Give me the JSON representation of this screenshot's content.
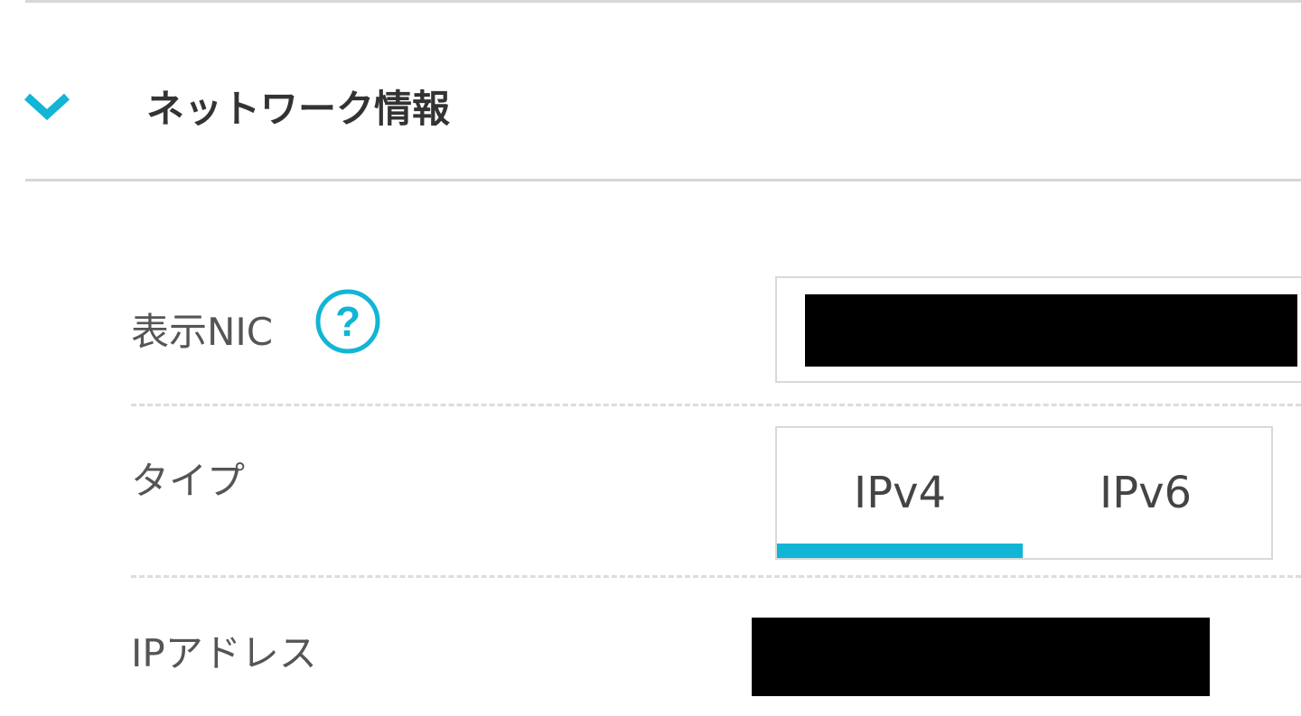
{
  "section": {
    "title": "ネットワーク情報",
    "expanded": true
  },
  "fields": {
    "nic": {
      "label": "表示NIC"
    },
    "type": {
      "label": "タイプ",
      "tabs": [
        {
          "label": "IPv4",
          "active": true
        },
        {
          "label": "IPv6",
          "active": false
        }
      ]
    },
    "ip": {
      "label": "IPアドレス"
    }
  },
  "colors": {
    "accent": "#12b5d6",
    "border": "#d9d9d9",
    "redaction": "#000000"
  },
  "icons": {
    "collapse": "chevron-down-icon",
    "help": "question-circle-icon"
  }
}
